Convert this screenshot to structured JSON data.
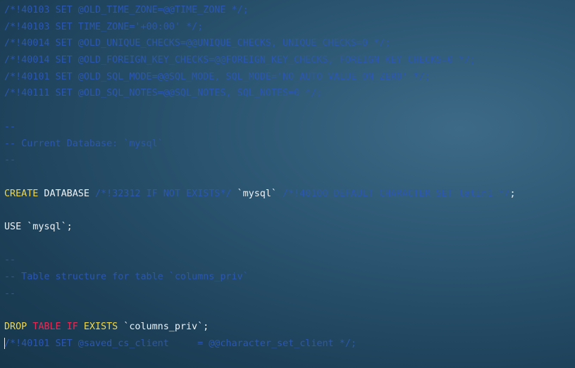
{
  "lines": [
    {
      "type": "comment",
      "text": "/*!40103 SET @OLD_TIME_ZONE=@@TIME_ZONE */;"
    },
    {
      "type": "comment",
      "text": "/*!40103 SET TIME_ZONE='+00:00' */;"
    },
    {
      "type": "comment",
      "text": "/*!40014 SET @OLD_UNIQUE_CHECKS=@@UNIQUE_CHECKS, UNIQUE_CHECKS=0 */;"
    },
    {
      "type": "comment",
      "text": "/*!40014 SET @OLD_FOREIGN_KEY_CHECKS=@@FOREIGN_KEY_CHECKS, FOREIGN_KEY_CHECKS=0 */;"
    },
    {
      "type": "comment",
      "text": "/*!40101 SET @OLD_SQL_MODE=@@SQL_MODE, SQL_MODE='NO_AUTO_VALUE_ON_ZERO' */;"
    },
    {
      "type": "comment",
      "text": "/*!40111 SET @OLD_SQL_NOTES=@@SQL_NOTES, SQL_NOTES=0 */;"
    },
    {
      "type": "blank"
    },
    {
      "type": "comment",
      "text": "--"
    },
    {
      "type": "comment",
      "text": "-- Current Database: `mysql`"
    },
    {
      "type": "comment",
      "text": "--"
    },
    {
      "type": "blank"
    },
    {
      "type": "create_db",
      "keyword": "CREATE",
      "word": " DATABASE ",
      "comment1": "/*!32312 IF NOT EXISTS*/",
      "name": " `mysql` ",
      "comment2": "/*!40100 DEFAULT CHARACTER SET latin1 */",
      "end": ";"
    },
    {
      "type": "blank"
    },
    {
      "type": "plain",
      "text": "USE `mysql`;"
    },
    {
      "type": "blank"
    },
    {
      "type": "comment",
      "text": "--"
    },
    {
      "type": "comment",
      "text": "-- Table structure for table `columns_priv`"
    },
    {
      "type": "comment",
      "text": "--"
    },
    {
      "type": "blank"
    },
    {
      "type": "drop",
      "kw1": "DROP",
      "kw2": "TABLE",
      "kw3": "IF",
      "kw4": "EXISTS",
      "name": " `columns_priv`;"
    },
    {
      "type": "cursor_comment",
      "text": "/*!40101 SET @saved_cs_client     = @@character_set_client */;"
    }
  ]
}
